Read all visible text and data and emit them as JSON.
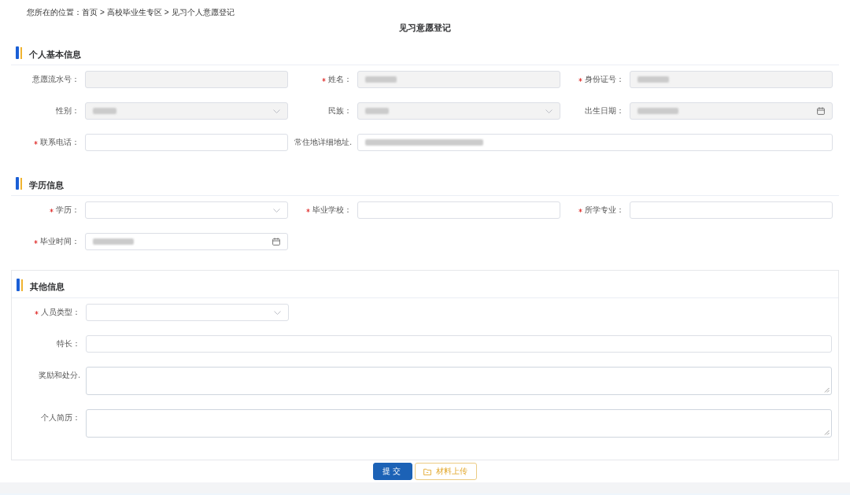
{
  "breadcrumb": {
    "prefix": "您所在的位置：",
    "separator": ">",
    "links": [
      "首页",
      "高校毕业生专区",
      "见习个人意愿登记"
    ]
  },
  "page_title": "见习意愿登记",
  "sections": [
    {
      "title": "个人基本信息",
      "boxed": false,
      "rows": [
        {
          "fields": [
            {
              "label": "意愿流水号：",
              "kind": "text",
              "required": false,
              "disabled": true,
              "blurred": false
            },
            {
              "label": "姓名：",
              "kind": "text",
              "required": true,
              "disabled": true,
              "blurred": true
            },
            {
              "label": "身份证号：",
              "kind": "text",
              "required": true,
              "disabled": true,
              "blurred": true
            }
          ]
        },
        {
          "fields": [
            {
              "label": "性别：",
              "kind": "select",
              "required": false,
              "disabled": true,
              "blurred": true
            },
            {
              "label": "民族：",
              "kind": "select",
              "required": false,
              "disabled": true,
              "blurred": true
            },
            {
              "label": "出生日期：",
              "kind": "date",
              "required": false,
              "disabled": true,
              "blurred": true
            }
          ]
        },
        {
          "fields": [
            {
              "label": "联系电话：",
              "kind": "text",
              "required": true,
              "disabled": false,
              "blurred": false
            },
            {
              "label": "常住地详细地址.",
              "kind": "long_text",
              "required": false,
              "disabled": false,
              "blurred": true
            }
          ]
        }
      ]
    },
    {
      "title": "学历信息",
      "boxed": false,
      "rows": [
        {
          "fields": [
            {
              "label": "学历：",
              "kind": "select",
              "required": true,
              "disabled": false,
              "blurred": false
            },
            {
              "label": "毕业学校：",
              "kind": "text",
              "required": true,
              "disabled": false,
              "blurred": false
            },
            {
              "label": "所学专业：",
              "kind": "text",
              "required": true,
              "disabled": false,
              "blurred": false
            }
          ]
        },
        {
          "fields": [
            {
              "label": "毕业时间：",
              "kind": "date",
              "required": true,
              "disabled": false,
              "blurred": true
            }
          ]
        }
      ]
    },
    {
      "title": "其他信息",
      "boxed": true,
      "rows": [
        {
          "fields": [
            {
              "label": "人员类型：",
              "kind": "select",
              "required": true,
              "disabled": false,
              "blurred": false
            }
          ]
        },
        {
          "fields": [
            {
              "label": "特长：",
              "kind": "long_text",
              "required": false,
              "disabled": false,
              "blurred": false
            }
          ]
        },
        {
          "fields": [
            {
              "label": "奖励和处分.",
              "kind": "textarea",
              "required": false,
              "disabled": false,
              "blurred": false
            }
          ]
        },
        {
          "fields": [
            {
              "label": "个人简历：",
              "kind": "textarea",
              "required": false,
              "disabled": false,
              "blurred": false
            }
          ]
        }
      ]
    }
  ],
  "buttons": [
    {
      "label": "提交",
      "kind": "primary"
    },
    {
      "label": "材料上传",
      "kind": "upload"
    }
  ]
}
